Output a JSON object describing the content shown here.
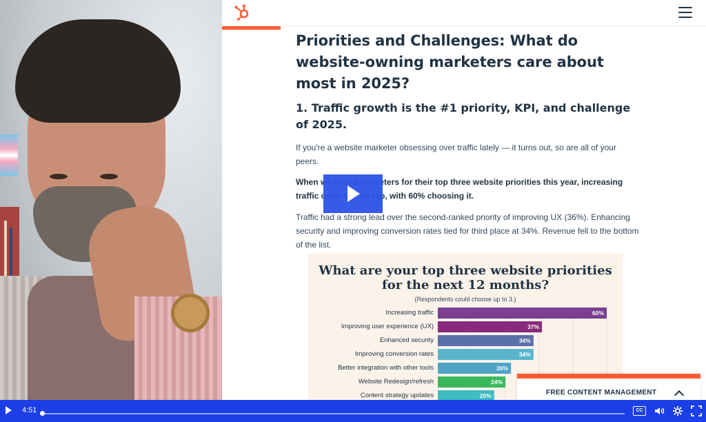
{
  "article": {
    "title": "Priorities and Challenges: What do website-owning marketers care about most in 2025?",
    "subtitle": "1. Traffic growth is the #1 priority, KPI, and challenge of 2025.",
    "para1": "If you're a website marketer obsessing over traffic lately — it turns out, so are all of your peers.",
    "para2": "When we asked marketers for their top three website priorities this year, increasing traffic came out on top, with 60% choosing it.",
    "para3": "Traffic had a strong lead over the second-ranked priority of improving UX (36%). Enhancing security and improving conversion rates tied for third place at 34%. Revenue fell to the bottom of the list."
  },
  "chart_data": {
    "type": "bar",
    "orientation": "horizontal",
    "title": "What are your top three website priorities for the next 12 months?",
    "subtitle": "(Respondents could choose up to 3.)",
    "categories": [
      "Increasing traffic",
      "Improving user experience (UX)",
      "Enhanced security",
      "Improving conversion rates",
      "Better integration with other tools",
      "Website Redesign/refresh",
      "Content strategy updates"
    ],
    "values": [
      60,
      37,
      34,
      34,
      26,
      24,
      20
    ],
    "value_labels": [
      "60%",
      "37%",
      "34%",
      "34%",
      "26%",
      "24%",
      "20%"
    ],
    "colors": [
      "#7a3f91",
      "#8a2a7c",
      "#5b6fa8",
      "#58b6cc",
      "#4fa3c7",
      "#3cb85c",
      "#3dbdc0"
    ],
    "xlim": [
      0,
      60
    ],
    "grid": true
  },
  "popup": {
    "label": "FREE CONTENT MANAGEMENT"
  },
  "player": {
    "time": "4:51",
    "cc_label": "CC",
    "progress": 0.0
  },
  "colors": {
    "accent": "#ff5c35",
    "player": "#1c3ee6",
    "play_overlay": "#2e55e6"
  }
}
